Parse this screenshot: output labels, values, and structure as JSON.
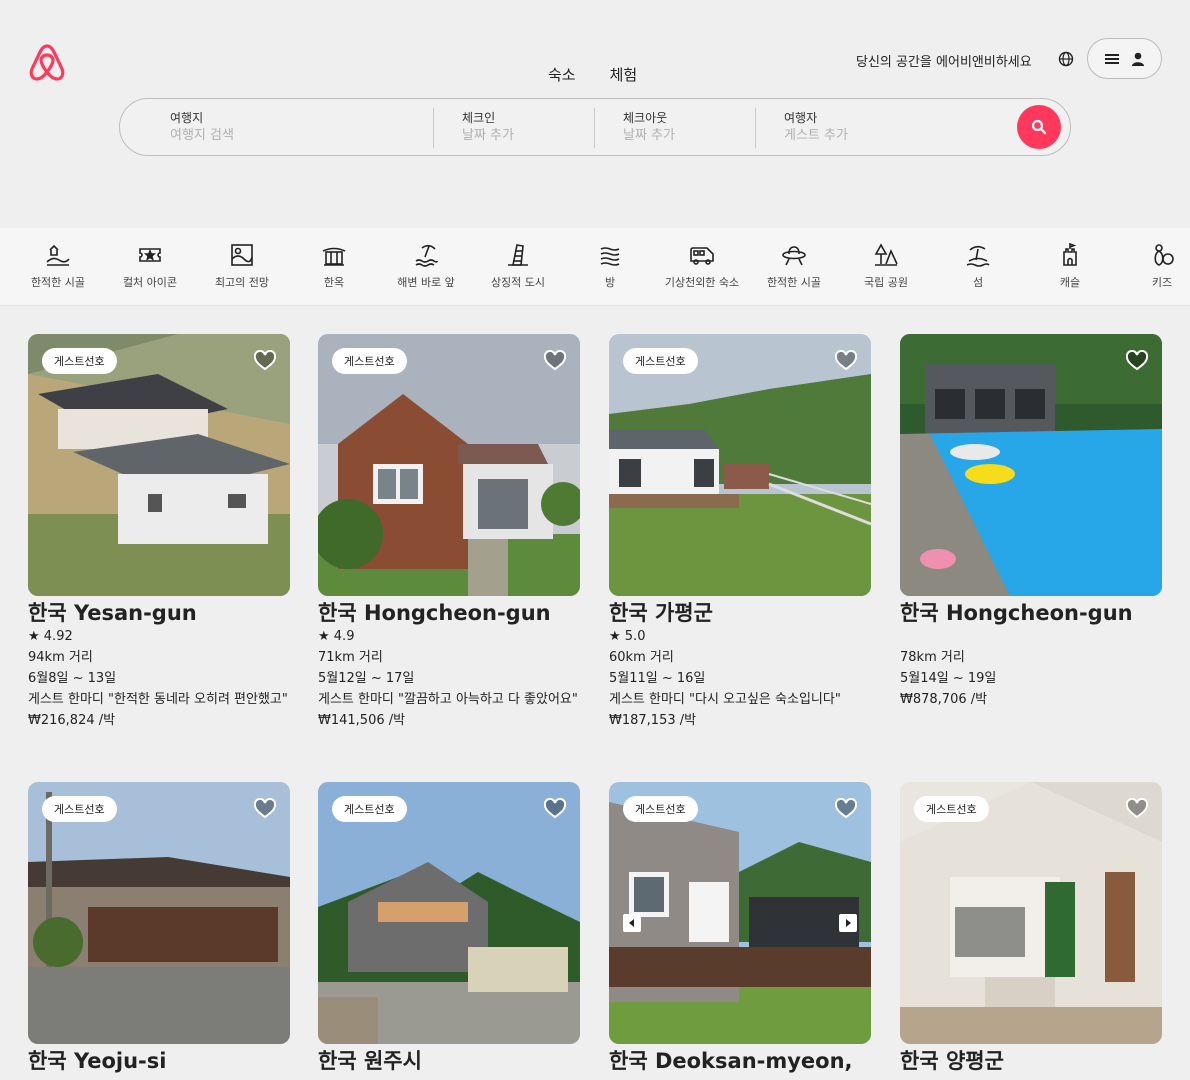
{
  "header": {
    "tabs": [
      "숙소",
      "체험"
    ],
    "host_link": "당신의 공간을 에어비앤비하세요"
  },
  "search": {
    "where_label": "여행지",
    "where_placeholder": "여행지 검색",
    "checkin_label": "체크인",
    "checkin_placeholder": "날짜 추가",
    "checkout_label": "체크아웃",
    "checkout_placeholder": "날짜 추가",
    "guests_label": "여행자",
    "guests_placeholder": "게스트 추가"
  },
  "categories": [
    {
      "label": "한적한 시골",
      "icon": "countryside-icon"
    },
    {
      "label": "컬처 아이콘",
      "icon": "ticket-icon"
    },
    {
      "label": "최고의 전망",
      "icon": "view-icon"
    },
    {
      "label": "한옥",
      "icon": "hanok-icon"
    },
    {
      "label": "해변 바로 앞",
      "icon": "beachfront-icon"
    },
    {
      "label": "상징적 도시",
      "icon": "city-icon"
    },
    {
      "label": "방",
      "icon": "room-icon"
    },
    {
      "label": "기상천외한 숙소",
      "icon": "bus-icon"
    },
    {
      "label": "한적한 시골",
      "icon": "ufo-icon"
    },
    {
      "label": "국립 공원",
      "icon": "park-icon"
    },
    {
      "label": "섬",
      "icon": "island-icon"
    },
    {
      "label": "캐슬",
      "icon": "castle-icon"
    },
    {
      "label": "키즈",
      "icon": "kids-icon"
    }
  ],
  "listings": [
    {
      "badge": "게스트선호",
      "title": "한국 Yesan-gun",
      "rating": "★ 4.92",
      "distance": "94km 거리",
      "dates": "6월8일 ~ 13일",
      "review": "게스트 한마디 \"한적한 동네라 오히려 편안했고\"",
      "price": "₩216,824 /박"
    },
    {
      "badge": "게스트선호",
      "title": "한국 Hongcheon-gun",
      "rating": "★ 4.9",
      "distance": "71km 거리",
      "dates": "5월12일 ~ 17일",
      "review": "게스트 한마디 \"깔끔하고 아늑하고 다 좋았어요\"",
      "price": "₩141,506 /박"
    },
    {
      "badge": "게스트선호",
      "title": "한국 가평군",
      "rating": "★ 5.0",
      "distance": "60km 거리",
      "dates": "5월11일 ~ 16일",
      "review": "게스트 한마디 \"다시 오고싶은 숙소입니다\"",
      "price": "₩187,153 /박"
    },
    {
      "badge": "",
      "title": "한국 Hongcheon-gun",
      "rating": "",
      "distance": "78km 거리",
      "dates": "5월14일 ~ 19일",
      "review": "",
      "price": "₩878,706 /박"
    },
    {
      "badge": "게스트선호",
      "title": "한국 Yeoju-si"
    },
    {
      "badge": "게스트선호",
      "title": "한국 원주시"
    },
    {
      "badge": "게스트선호",
      "title": "한국 Deoksan-myeon,"
    },
    {
      "badge": "게스트선호",
      "title": "한국 양평군"
    }
  ]
}
